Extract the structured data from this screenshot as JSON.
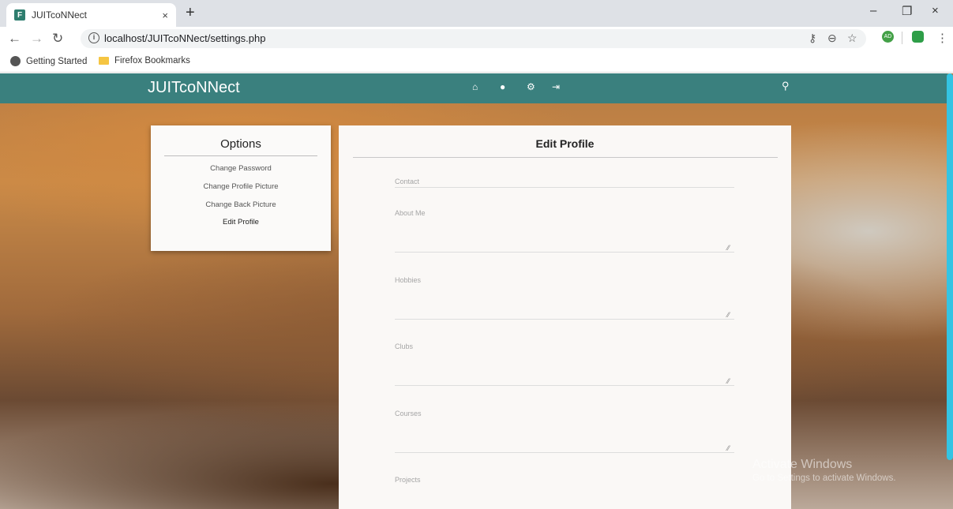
{
  "browser": {
    "tab_title": "JUITcoNNect",
    "favicon_letter": "F",
    "tab_close": "×",
    "new_tab": "+",
    "window": {
      "minimize": "–",
      "restore": "❐",
      "close": "×"
    },
    "url": "localhost/JUITcoNNect/settings.php",
    "bookmarks": [
      "Getting Started",
      "Firefox Bookmarks"
    ],
    "extensions": {
      "profile_badge": "AD",
      "accent": "#2e9e48"
    }
  },
  "app": {
    "brand": "JUITcoNNect",
    "nav_color": "#3a807e",
    "nav_icons": [
      "home-icon",
      "user-icon",
      "cogs-icon",
      "sign-out-icon"
    ],
    "search_icon": "search-icon"
  },
  "options": {
    "title": "Options",
    "items": [
      "Change Password",
      "Change Profile Picture",
      "Change Back Picture",
      "Edit Profile"
    ]
  },
  "profile": {
    "title": "Edit Profile",
    "fields": [
      {
        "label": "Contact",
        "type": "input"
      },
      {
        "label": "About Me",
        "type": "textarea"
      },
      {
        "label": "Hobbies",
        "type": "textarea"
      },
      {
        "label": "Clubs",
        "type": "textarea"
      },
      {
        "label": "Courses",
        "type": "textarea"
      },
      {
        "label": "Projects",
        "type": "textarea"
      }
    ]
  },
  "watermark": {
    "line1": "Activate Windows",
    "line2": "Go to Settings to activate Windows."
  }
}
